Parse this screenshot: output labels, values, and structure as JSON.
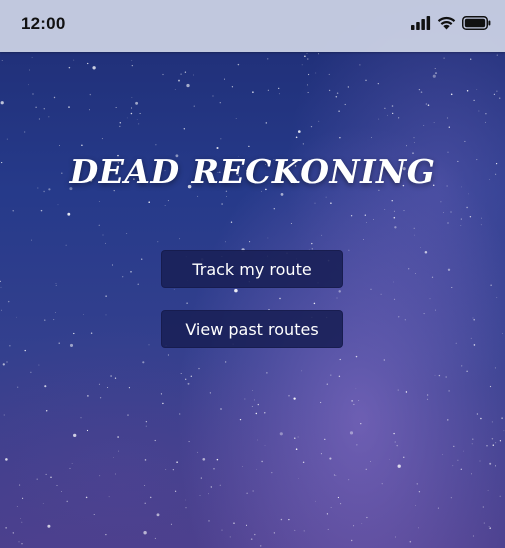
{
  "status_bar": {
    "time": "12:00",
    "icons": [
      "cellular-signal-icon",
      "wifi-icon",
      "battery-icon"
    ]
  },
  "app": {
    "title": "DEAD RECKONING"
  },
  "actions": {
    "track_label": "Track my route",
    "past_label": "View past routes"
  },
  "colors": {
    "button_bg": "#19205a",
    "title_text": "#ffffff",
    "status_bar_bg": "#cdd4e6"
  }
}
